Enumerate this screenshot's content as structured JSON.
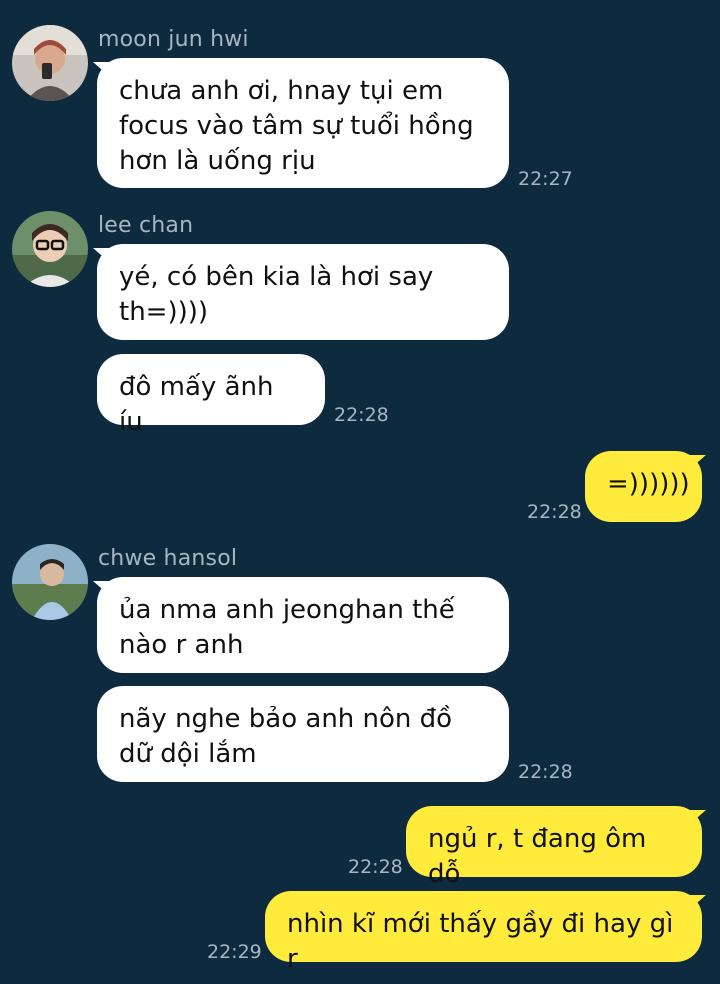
{
  "colors": {
    "background": "#0e2a3f",
    "incoming_bubble": "#ffffff",
    "outgoing_bubble": "#ffeb3b",
    "meta_text": "#a7b6c2"
  },
  "messages": [
    {
      "sender": "moon jun hwi",
      "avatar": "avatar-moon-jun-hwi",
      "texts": [
        "chưa anh ơi, hnay tụi em\nfocus vào tâm sự tuổi hồng\nhơn là uống rịu"
      ],
      "time": "22:27"
    },
    {
      "sender": "lee chan",
      "avatar": "avatar-lee-chan",
      "texts": [
        "yé, có bên kia là hơi say\nth=))))",
        "đô mấy ãnh íu"
      ],
      "time": "22:28"
    },
    {
      "outgoing": true,
      "texts": [
        "=))))))"
      ],
      "time": "22:28"
    },
    {
      "sender": "chwe hansol",
      "avatar": "avatar-chwe-hansol",
      "texts": [
        "ủa nma anh jeonghan thế\nnào r anh",
        "nãy nghe bảo anh nôn đồ\ndữ dội lắm"
      ],
      "time": "22:28"
    },
    {
      "outgoing": true,
      "texts": [
        "ngủ r, t đang ôm dỗ"
      ],
      "time": "22:28"
    },
    {
      "outgoing": true,
      "texts": [
        "nhìn kĩ mới thấy gầy đi hay gì r"
      ],
      "time": "22:29"
    }
  ]
}
